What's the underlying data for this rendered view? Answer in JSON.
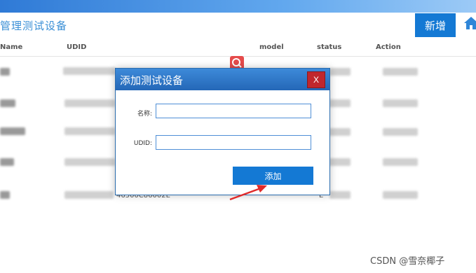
{
  "header": {
    "title": "管理测试设备",
    "add_label": "新增"
  },
  "table": {
    "columns": [
      "Name",
      "UDID",
      "model",
      "status",
      "Action"
    ],
    "row5": {
      "udid_fragment": "46500C86002E",
      "status_fragment": "E"
    }
  },
  "dialog": {
    "title": "添加测试设备",
    "close_label": "X",
    "name_label": "名称:",
    "name_value": "",
    "udid_label": "UDID:",
    "udid_value": "",
    "submit_label": "添加"
  },
  "icons": {
    "home": "home-icon",
    "search": "search-icon",
    "annotation": "red-arrow-icon"
  },
  "colors": {
    "primary": "#1479d4",
    "close": "#c0272d",
    "arrow": "#e02a2a"
  },
  "watermark": "CSDN @雪奈椰子"
}
